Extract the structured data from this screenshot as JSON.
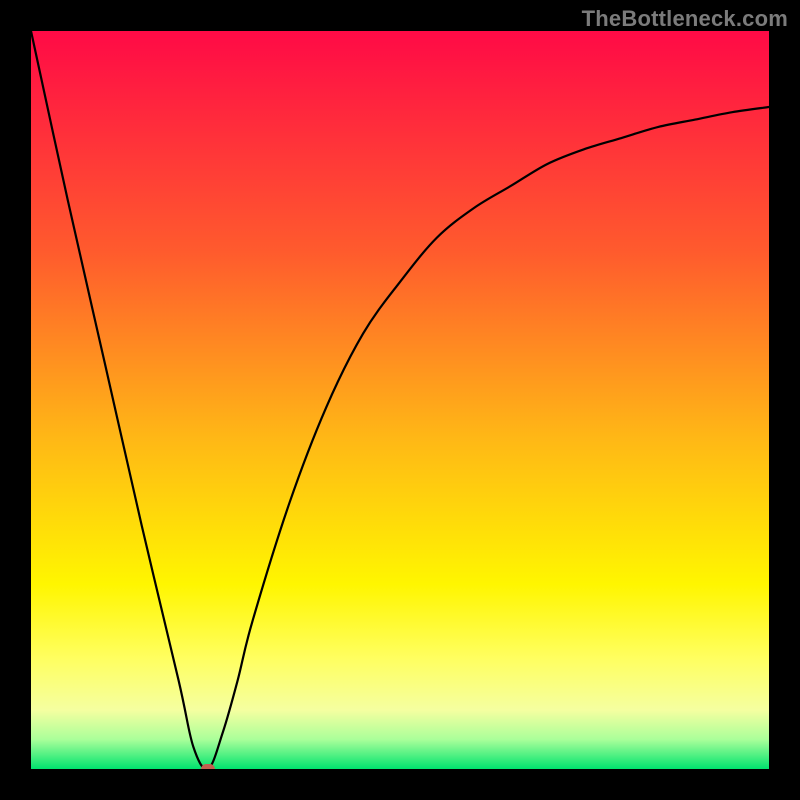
{
  "watermark": "TheBottleneck.com",
  "chart_data": {
    "type": "line",
    "title": "",
    "xlabel": "",
    "ylabel": "",
    "xlim": [
      0,
      100
    ],
    "ylim": [
      0,
      100
    ],
    "grid": false,
    "legend": false,
    "series": [
      {
        "name": "bottleneck-curve",
        "x": [
          0,
          5,
          10,
          15,
          20,
          22,
          24,
          26,
          28,
          30,
          35,
          40,
          45,
          50,
          55,
          60,
          65,
          70,
          75,
          80,
          85,
          90,
          95,
          100
        ],
        "y": [
          100,
          77,
          55,
          33,
          12,
          3,
          0,
          5,
          12,
          20,
          36,
          49,
          59,
          66,
          72,
          76,
          79,
          82,
          84,
          85.5,
          87,
          88,
          89,
          89.7
        ]
      }
    ],
    "marker": {
      "x": 24,
      "y": 0,
      "name": "optimal-point"
    },
    "background": {
      "type": "vertical-gradient",
      "stops": [
        {
          "pos": 0,
          "color": "#ff0a46"
        },
        {
          "pos": 30,
          "color": "#ff5b2d"
        },
        {
          "pos": 55,
          "color": "#ffb716"
        },
        {
          "pos": 75,
          "color": "#fff600"
        },
        {
          "pos": 85,
          "color": "#ffff60"
        },
        {
          "pos": 92,
          "color": "#f5ffa0"
        },
        {
          "pos": 96,
          "color": "#aaff9a"
        },
        {
          "pos": 100,
          "color": "#00e36e"
        }
      ]
    }
  }
}
